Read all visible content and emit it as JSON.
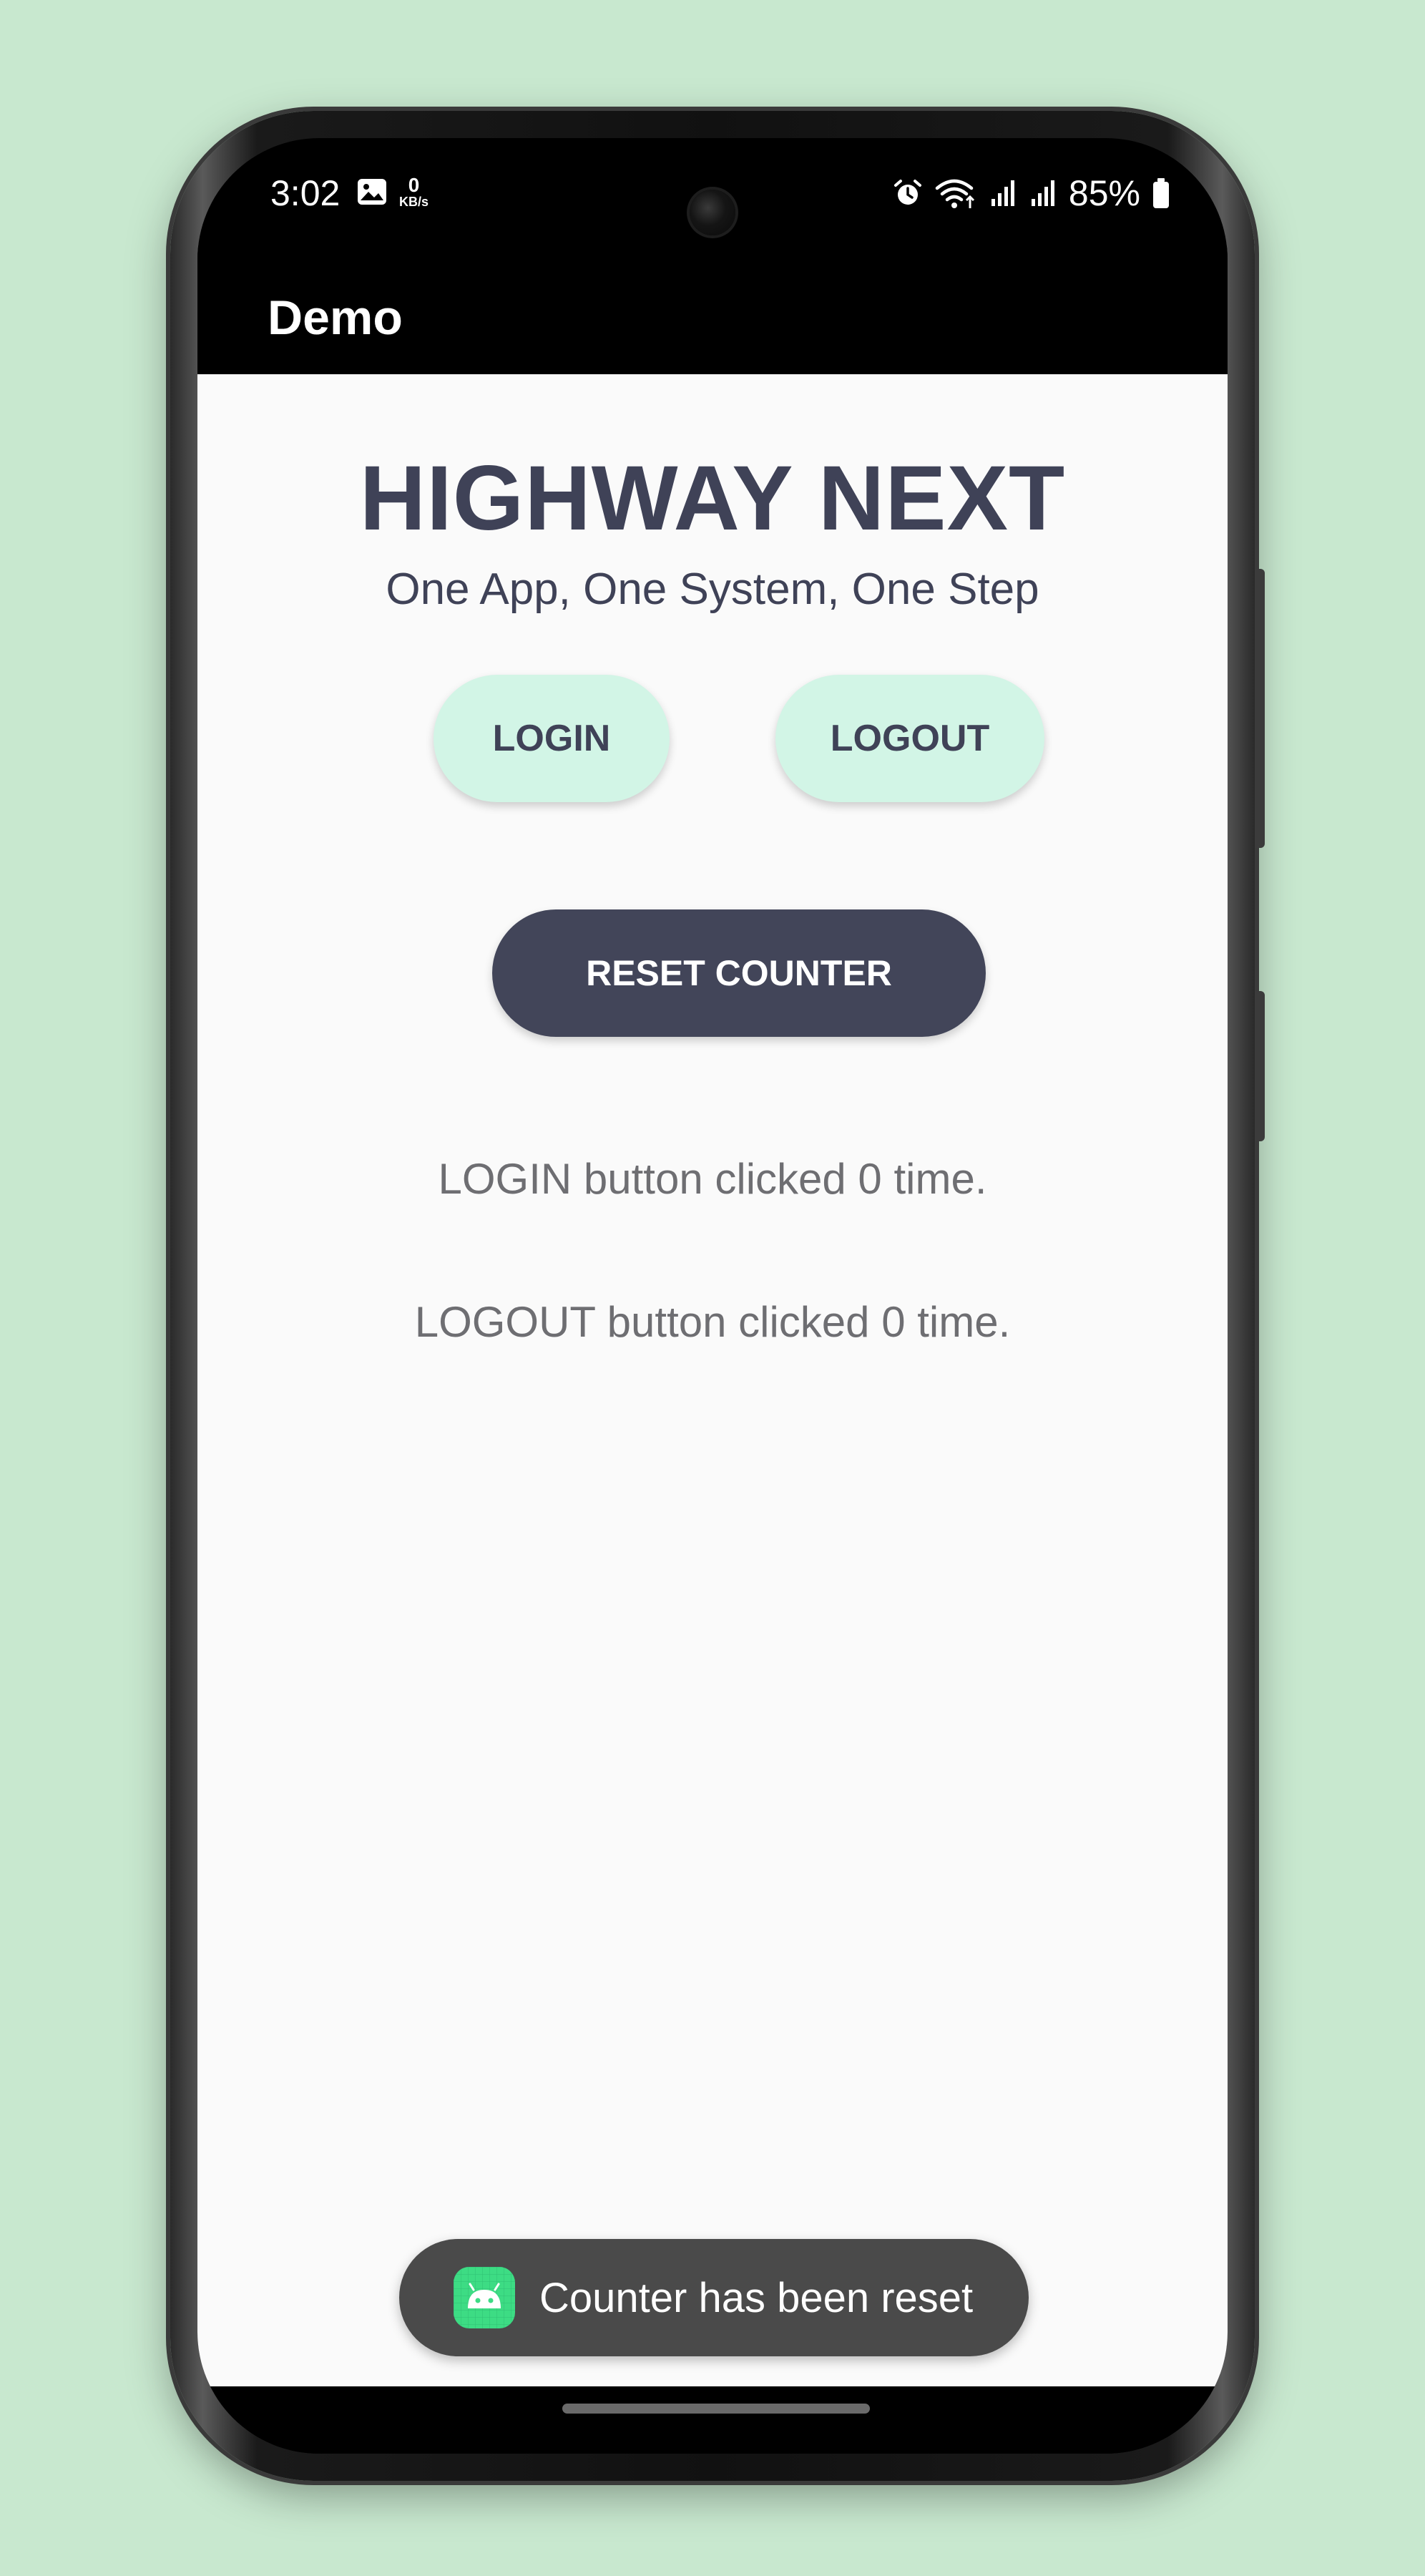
{
  "status_bar": {
    "time": "3:02",
    "speed_value": "0",
    "speed_unit": "KB/s",
    "battery": "85%"
  },
  "app_bar": {
    "title": "Demo"
  },
  "brand": {
    "title": "HIGHWAY NEXT",
    "subtitle": "One App, One System, One Step"
  },
  "buttons": {
    "login": "LOGIN",
    "logout": "LOGOUT",
    "reset": "RESET COUNTER"
  },
  "counters": {
    "login_text": "LOGIN button clicked 0 time.",
    "logout_text": "LOGOUT button clicked 0 time."
  },
  "toast": {
    "message": "Counter has been reset"
  },
  "colors": {
    "background": "#c8e8cf",
    "primary_dark": "#424559",
    "accent_light": "#d2f5e6",
    "toast_bg": "#4a4a4a",
    "android_green": "#3ddc84"
  }
}
